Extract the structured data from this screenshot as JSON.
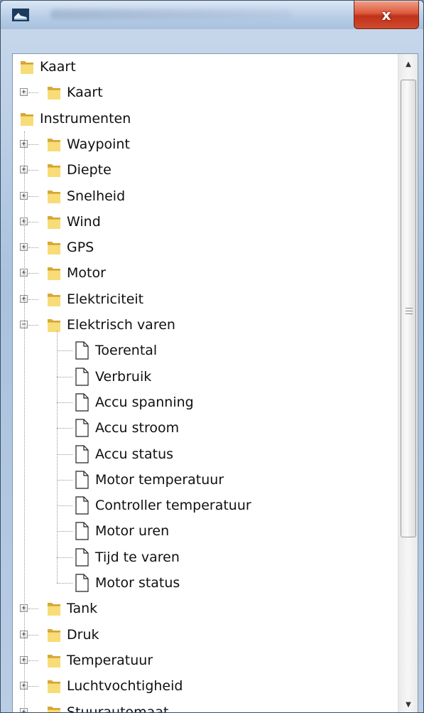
{
  "window": {
    "close_glyph": "x"
  },
  "tree": [
    {
      "label": "Kaart",
      "level": 0,
      "kind": "folder",
      "expander": "none"
    },
    {
      "label": "Kaart",
      "level": 1,
      "kind": "folder",
      "expander": "+"
    },
    {
      "label": "Instrumenten",
      "level": 0,
      "kind": "folder",
      "expander": "none"
    },
    {
      "label": "Waypoint",
      "level": 1,
      "kind": "folder",
      "expander": "+"
    },
    {
      "label": "Diepte",
      "level": 1,
      "kind": "folder",
      "expander": "+"
    },
    {
      "label": "Snelheid",
      "level": 1,
      "kind": "folder",
      "expander": "+"
    },
    {
      "label": "Wind",
      "level": 1,
      "kind": "folder",
      "expander": "+"
    },
    {
      "label": "GPS",
      "level": 1,
      "kind": "folder",
      "expander": "+"
    },
    {
      "label": "Motor",
      "level": 1,
      "kind": "folder",
      "expander": "+"
    },
    {
      "label": "Elektriciteit",
      "level": 1,
      "kind": "folder",
      "expander": "+"
    },
    {
      "label": "Elektrisch varen",
      "level": 1,
      "kind": "folder",
      "expander": "-"
    },
    {
      "label": "Toerental",
      "level": 2,
      "kind": "doc",
      "expander": "none"
    },
    {
      "label": "Verbruik",
      "level": 2,
      "kind": "doc",
      "expander": "none"
    },
    {
      "label": "Accu spanning",
      "level": 2,
      "kind": "doc",
      "expander": "none"
    },
    {
      "label": "Accu stroom",
      "level": 2,
      "kind": "doc",
      "expander": "none"
    },
    {
      "label": "Accu status",
      "level": 2,
      "kind": "doc",
      "expander": "none"
    },
    {
      "label": "Motor temperatuur",
      "level": 2,
      "kind": "doc",
      "expander": "none"
    },
    {
      "label": "Controller temperatuur",
      "level": 2,
      "kind": "doc",
      "expander": "none"
    },
    {
      "label": "Motor uren",
      "level": 2,
      "kind": "doc",
      "expander": "none"
    },
    {
      "label": "Tijd te varen",
      "level": 2,
      "kind": "doc",
      "expander": "none"
    },
    {
      "label": "Motor status",
      "level": 2,
      "kind": "doc",
      "expander": "none"
    },
    {
      "label": "Tank",
      "level": 1,
      "kind": "folder",
      "expander": "+"
    },
    {
      "label": "Druk",
      "level": 1,
      "kind": "folder",
      "expander": "+"
    },
    {
      "label": "Temperatuur",
      "level": 1,
      "kind": "folder",
      "expander": "+"
    },
    {
      "label": "Luchtvochtigheid",
      "level": 1,
      "kind": "folder",
      "expander": "+"
    },
    {
      "label": "Stuurautomaat",
      "level": 1,
      "kind": "folder",
      "expander": "+"
    }
  ],
  "scrollbar": {
    "up_glyph": "▲",
    "down_glyph": "▼"
  },
  "colors": {
    "folder_light": "#f7dc78",
    "folder_dark": "#d9a934",
    "close_red": "#c0321a"
  }
}
